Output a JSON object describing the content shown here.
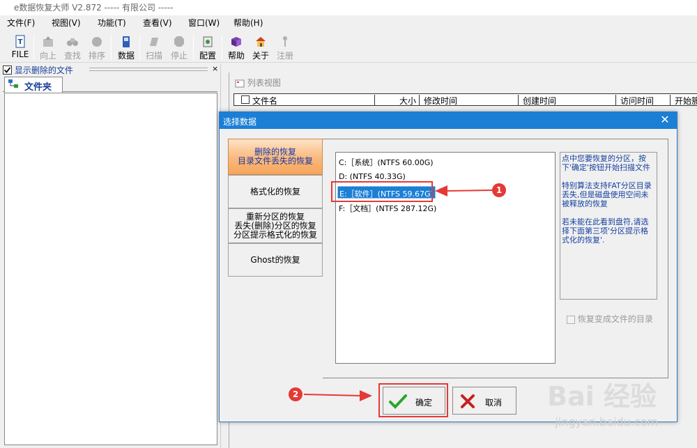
{
  "app": {
    "title": "e数据恢复大师 V2.872  -----           有限公司 -----"
  },
  "menu": [
    "文件(F)",
    "视图(V)",
    "功能(T)",
    "查看(V)",
    "窗口(W)",
    "帮助(H)"
  ],
  "toolbar": [
    "FILE",
    "向上",
    "查找",
    "排序",
    "数据",
    "扫描",
    "停止",
    "配置",
    "帮助",
    "关于",
    "注册"
  ],
  "left_pane": {
    "checkbox_label": "显示删除的文件",
    "tab_label": "文件夹"
  },
  "list_view": {
    "title": "列表视图",
    "columns": [
      "文件名",
      "大小",
      "修改时间",
      "创建时间",
      "访问时间",
      "开始簇"
    ]
  },
  "dialog": {
    "title": "选择数据",
    "close": "✕",
    "tabs": [
      {
        "lines": [
          "删除的恢复",
          "目录文件丢失的恢复"
        ]
      },
      {
        "lines": [
          "格式化的恢复"
        ]
      },
      {
        "lines": [
          "重新分区的恢复",
          "丢失(删除)分区的恢复",
          "分区提示格式化的恢复"
        ]
      },
      {
        "lines": [
          "Ghost的恢复"
        ]
      }
    ],
    "drives": [
      "C:［系统］(NTFS 60.00G)",
      "D:  (NTFS 40.33G)",
      "E:［软件］(NTFS 59.67G)",
      "F:［文档］(NTFS 287.12G)"
    ],
    "info": [
      "点中您要恢复的分区，按下'确定'按钮开始扫描文件",
      "特别算法支持FAT分区目录丢失,但是磁盘使用空间未被释放的恢复",
      "若未能在此看到盘符,请选择下面第三项'分区提示格式化的恢复'."
    ],
    "restore_dir_label": "恢复变成文件的目录",
    "ok_label": "确定",
    "cancel_label": "取消"
  },
  "annotations": [
    "1",
    "2"
  ],
  "watermark": {
    "brand": "Bai 经验",
    "url": "jingyan.baidu.com"
  },
  "colors": {
    "accent": "#1b7fd6",
    "highlight": "#e53935",
    "active_tab": "#f6a55b"
  }
}
